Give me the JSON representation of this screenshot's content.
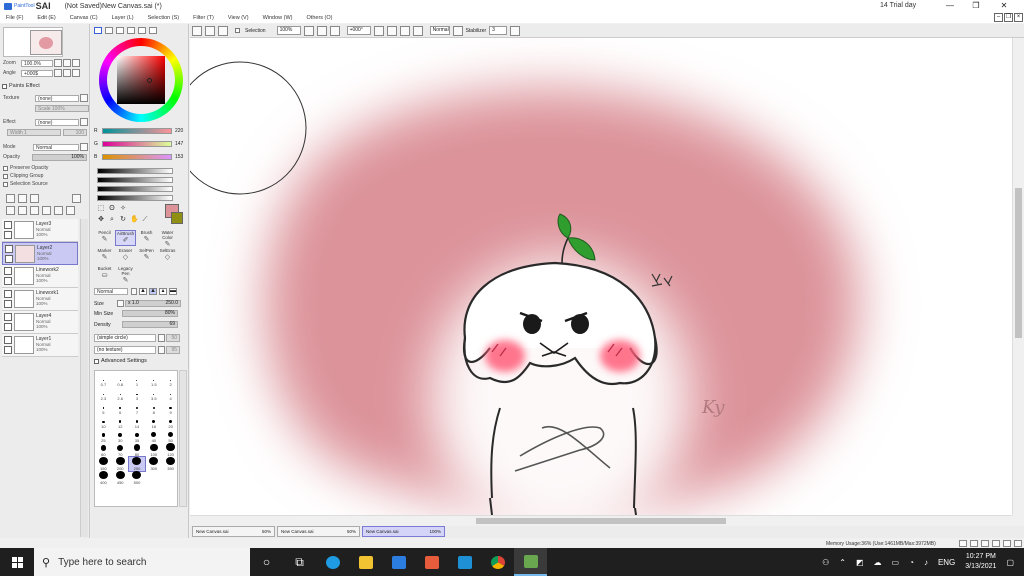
{
  "titlebar": {
    "app_brand": "PaintTool",
    "app_name": "SAI",
    "doc_title": "(Not Saved)New Canvas.sai (*)",
    "trial": "14 Trial day"
  },
  "menu": [
    "File (F)",
    "Edit (E)",
    "Canvas (C)",
    "Layer (L)",
    "Selection (S)",
    "Filter (T)",
    "View (V)",
    "Window (W)",
    "Others (O)"
  ],
  "navigator": {
    "zoom_label": "Zoom",
    "zoom_value": "100.0%",
    "angle_label": "Angle",
    "angle_value": "+000$"
  },
  "paints_effect": {
    "header": "Paints Effect",
    "texture_label": "Texture",
    "texture_value": "(none)",
    "scale_label": "Scale",
    "scale_value": "100%",
    "scale_num": "20",
    "effect_label": "Effect",
    "effect_value": "(none)",
    "width_label": "Width",
    "width_value": "1",
    "width_num": "100"
  },
  "layer_props": {
    "mode_label": "Mode",
    "mode_value": "Normal",
    "opacity_label": "Opacity",
    "opacity_value": "100%",
    "preserve_opacity": "Preserve Opacity",
    "clipping_group": "Clipping Group",
    "selection_source": "Selection Source"
  },
  "layers": [
    {
      "name": "Layer3",
      "mode": "Normal",
      "opacity": "100%",
      "selected": false
    },
    {
      "name": "Layer2",
      "mode": "Normal",
      "opacity": "100%",
      "selected": true
    },
    {
      "name": "Linework2",
      "mode": "Normal",
      "opacity": "100%",
      "selected": false
    },
    {
      "name": "Linework1",
      "mode": "Normal",
      "opacity": "100%",
      "selected": false
    },
    {
      "name": "Layer4",
      "mode": "Normal",
      "opacity": "100%",
      "selected": false
    },
    {
      "name": "Layer1",
      "mode": "Normal",
      "opacity": "100%",
      "selected": false
    }
  ],
  "color": {
    "r_label": "R",
    "r_value": "220",
    "g_label": "G",
    "g_value": "147",
    "b_label": "B",
    "b_value": "153",
    "main_color": "#dc939a",
    "sub_color": "#8f8f14"
  },
  "brushes": [
    {
      "label": "Pencil",
      "selected": false
    },
    {
      "label": "AirBrush",
      "selected": true
    },
    {
      "label": "Brush",
      "selected": false
    },
    {
      "label": "Water Color",
      "selected": false
    },
    {
      "label": "Marker",
      "selected": false
    },
    {
      "label": "Eraser",
      "selected": false
    },
    {
      "label": "SelPen",
      "selected": false
    },
    {
      "label": "SelEras",
      "selected": false
    },
    {
      "label": "Bucket",
      "selected": false
    },
    {
      "label": "Legacy Pen",
      "selected": false
    }
  ],
  "brush_settings": {
    "blend_mode": "Normal",
    "size_label": "Size",
    "size_mult": "x 1.0",
    "size_value": "250.0",
    "min_size_label": "Min Size",
    "min_size_value": "80%",
    "density_label": "Density",
    "density_value": "69",
    "shape": "(simple circle)",
    "shape_num": "50",
    "texture": "(no texture)",
    "texture_num": "95",
    "advanced": "Advanced Settings"
  },
  "brush_sizes": [
    "0.7",
    "0.8",
    "1",
    "1.5",
    "2",
    "2.3",
    "2.6",
    "3",
    "3.5",
    "4",
    "5",
    "6",
    "7",
    "8",
    "9",
    "10",
    "12",
    "14",
    "16",
    "20",
    "25",
    "30",
    "35",
    "40",
    "50",
    "60",
    "70",
    "80",
    "100",
    "120",
    "150",
    "200",
    "250",
    "300",
    "350",
    "400",
    "450",
    "500"
  ],
  "selected_size": "250",
  "toolbar": {
    "selection_label": "Selection",
    "zoom": "100%",
    "angle": "+000°",
    "blend": "Normal",
    "stabilizer_label": "Stabilizer",
    "stabilizer_value": "3"
  },
  "doc_tabs": [
    {
      "name": "New Canvas.sai",
      "zoom": "50%",
      "active": false
    },
    {
      "name": "New Canvas.sai",
      "zoom": "50%",
      "active": false
    },
    {
      "name": "New Canvas.sai",
      "zoom": "100%",
      "active": true
    }
  ],
  "status": {
    "memory": "Memory Usage:36% (Use:1461MB/Max:3972MB)"
  },
  "canvas_art": {
    "signature": "Ky"
  },
  "taskbar": {
    "search_placeholder": "Type here to search",
    "language": "ENG",
    "time": "10:27 PM",
    "date": "3/13/2021"
  }
}
